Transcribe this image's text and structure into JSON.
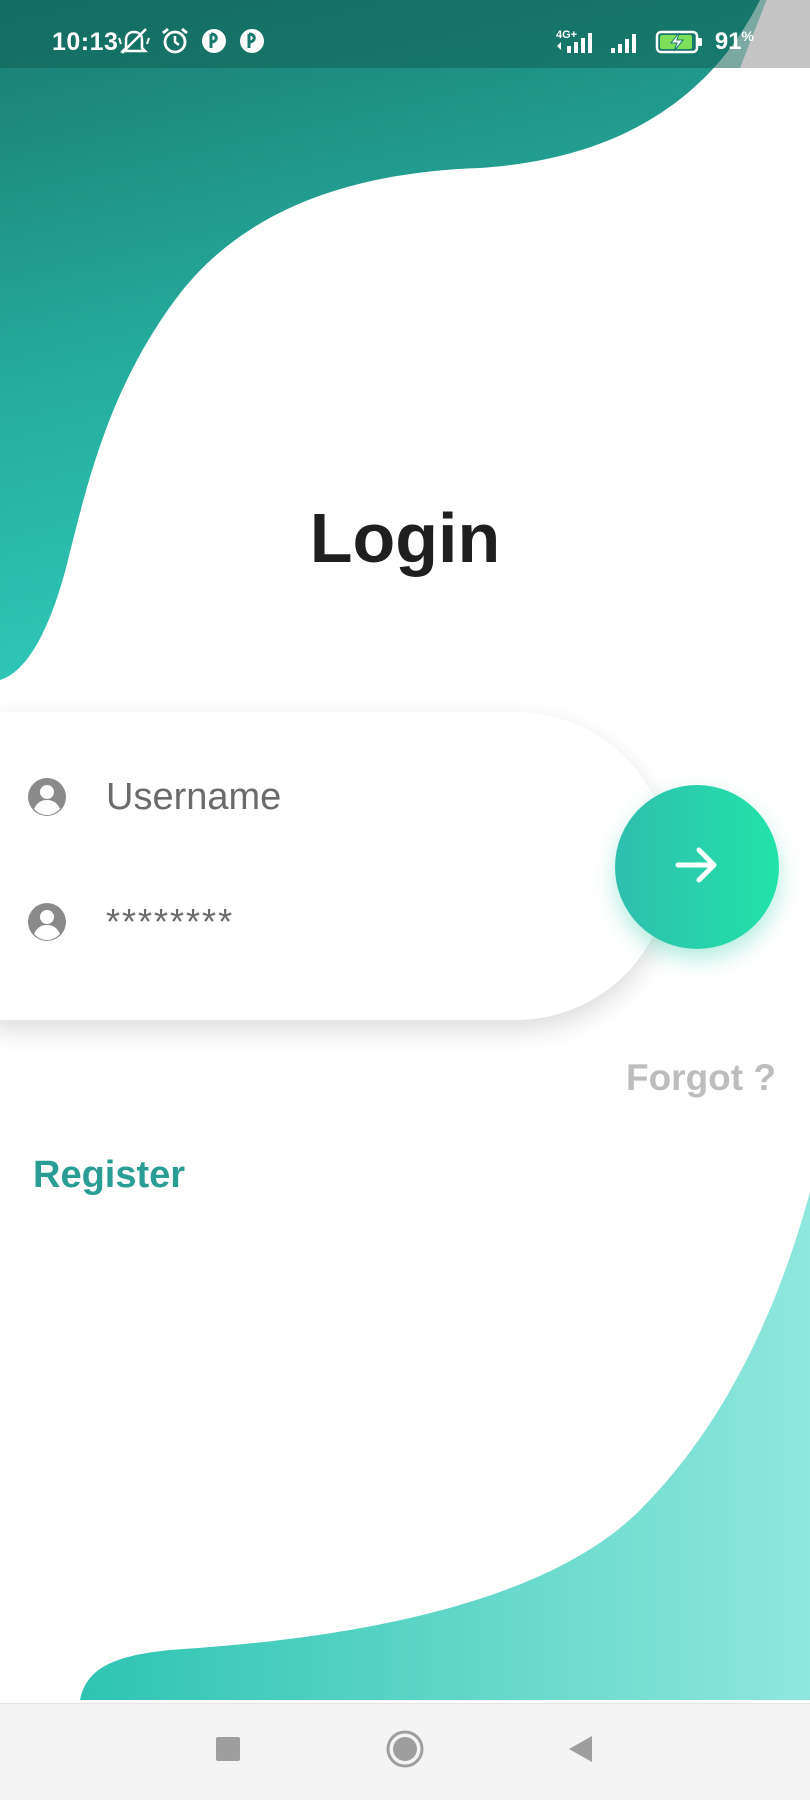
{
  "status_bar": {
    "time": "10:13",
    "network_label": "4G+",
    "battery_percent": "91",
    "battery_unit": "%"
  },
  "screen": {
    "title": "Login"
  },
  "form": {
    "username_placeholder": "Username",
    "password_value": "********"
  },
  "links": {
    "forgot": "Forgot ?",
    "register": "Register"
  },
  "icons": {
    "status_left": [
      "muted-notification-icon",
      "alarm-icon",
      "app-notification-icon",
      "app-notification-icon"
    ],
    "status_right": [
      "signal-icon",
      "signal-icon",
      "battery-charging-icon"
    ],
    "username_field": "account-circle-icon",
    "password_field": "account-circle-icon",
    "submit": "arrow-right-icon",
    "nav": [
      "recents-square-icon",
      "home-circle-icon",
      "back-triangle-icon"
    ]
  },
  "colors": {
    "accent_dark": "#1e7f76",
    "accent": "#2ec2b3",
    "accent_light": "#8ee6dc",
    "button_gradient_start": "#2fbeae",
    "button_gradient_end": "#22e3a9",
    "register_text": "#2a9e94",
    "forgot_text": "#bdbdbd",
    "title_text": "#1f1f1f"
  }
}
